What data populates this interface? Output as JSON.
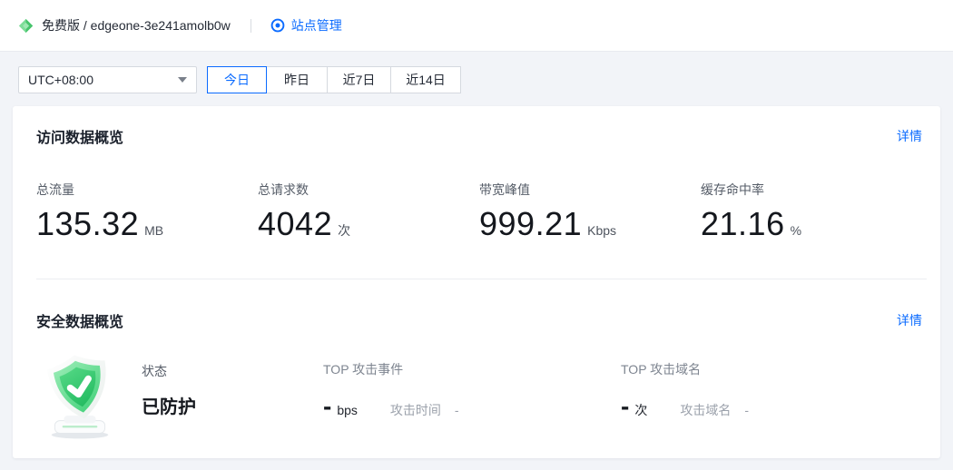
{
  "header": {
    "breadcrumb": "免费版 / edgeone-3e241amolb0w",
    "site_management": "站点管理"
  },
  "controls": {
    "timezone": "UTC+08:00",
    "ranges": [
      {
        "label": "今日",
        "selected": true
      },
      {
        "label": "昨日",
        "selected": false
      },
      {
        "label": "近7日",
        "selected": false
      },
      {
        "label": "近14日",
        "selected": false
      }
    ]
  },
  "access_overview": {
    "title": "访问数据概览",
    "detail_link": "详情",
    "metrics": [
      {
        "label": "总流量",
        "value": "135.32",
        "unit": "MB"
      },
      {
        "label": "总请求数",
        "value": "4042",
        "unit": "次"
      },
      {
        "label": "带宽峰值",
        "value": "999.21",
        "unit": "Kbps"
      },
      {
        "label": "缓存命中率",
        "value": "21.16",
        "unit": "%"
      }
    ]
  },
  "security_overview": {
    "title": "安全数据概览",
    "detail_link": "详情",
    "status": {
      "label": "状态",
      "value": "已防护"
    },
    "shield_icon": "protected-shield-icon",
    "top_attack_event": {
      "title": "TOP 攻击事件",
      "value": "-",
      "unit": "bps",
      "sub_label": "攻击时间",
      "sub_value": "-"
    },
    "top_attack_domain": {
      "title": "TOP 攻击域名",
      "value": "-",
      "unit": "次",
      "sub_label": "攻击域名",
      "sub_value": "-"
    }
  },
  "colors": {
    "accent_blue": "#0b6bff",
    "shield_green": "#35c96e",
    "page_background": "#f2f4f8",
    "card_background": "#ffffff"
  }
}
